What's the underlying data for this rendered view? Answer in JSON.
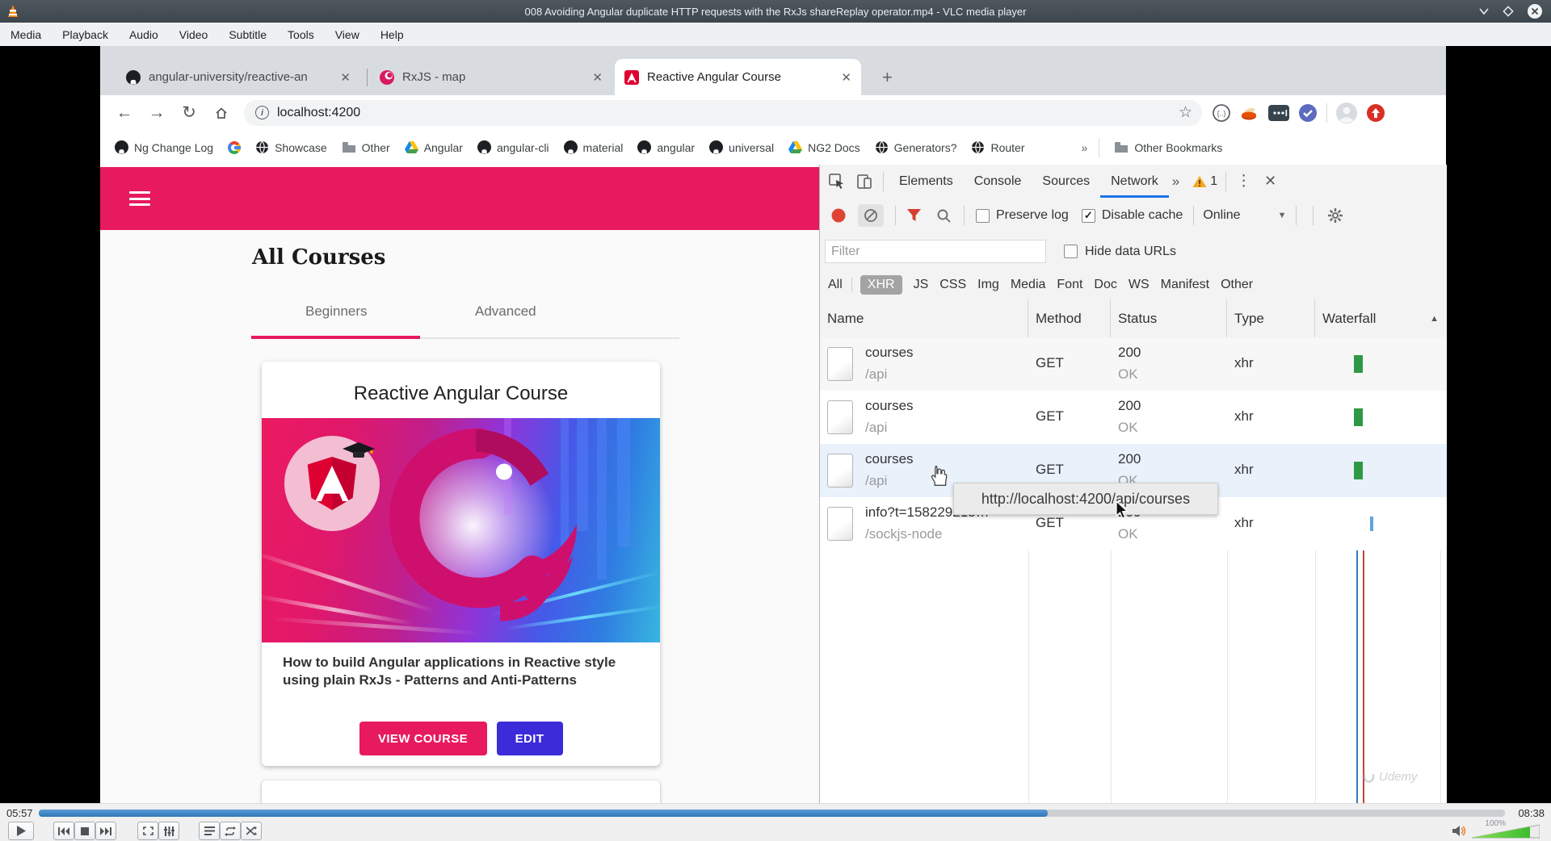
{
  "vlc": {
    "title": "008 Avoiding Angular duplicate HTTP requests with the RxJs shareReplay operator.mp4 - VLC media player",
    "menu": [
      "Media",
      "Playback",
      "Audio",
      "Video",
      "Subtitle",
      "Tools",
      "View",
      "Help"
    ],
    "time_elapsed": "05:57",
    "time_total": "08:38",
    "progress_percent": 68.8,
    "volume_label": "100%",
    "volume_percent": 100
  },
  "browser": {
    "tabs": [
      {
        "label": "angular-university/reactive-an",
        "icon": "github"
      },
      {
        "label": "RxJS - map",
        "icon": "rxjs"
      },
      {
        "label": "Reactive Angular Course",
        "icon": "angular"
      }
    ],
    "address": "localhost:4200",
    "bookmarks": {
      "b0": "Ng Change Log",
      "b1": "Showcase",
      "b2": "Other",
      "b3": "Angular",
      "b4": "angular-cli",
      "b5": "material",
      "b6": "angular",
      "b7": "universal",
      "b8": "NG2 Docs",
      "b9": "Generators?",
      "b10": "Router",
      "overflow": "»",
      "other": "Other Bookmarks"
    }
  },
  "page": {
    "title": "All Courses",
    "tabs": {
      "t0": "Beginners",
      "t1": "Advanced"
    },
    "card": {
      "title": "Reactive Angular Course",
      "description": "How to build Angular applications in Reactive style using plain RxJs - Patterns and Anti-Patterns",
      "view_label": "VIEW COURSE",
      "edit_label": "EDIT"
    }
  },
  "devtools": {
    "tabs": {
      "t0": "Elements",
      "t1": "Console",
      "t2": "Sources",
      "t3": "Network"
    },
    "active_tab": "Network",
    "warning_count": "1",
    "toolbar": {
      "preserve_log": "Preserve log",
      "disable_cache": "Disable cache",
      "throttling": "Online"
    },
    "filter_placeholder": "Filter",
    "hide_data_urls": "Hide data URLs",
    "type_filters": {
      "f0": "All",
      "f1": "XHR",
      "f2": "JS",
      "f3": "CSS",
      "f4": "Img",
      "f5": "Media",
      "f6": "Font",
      "f7": "Doc",
      "f8": "WS",
      "f9": "Manifest",
      "f10": "Other"
    },
    "selected_filter": "XHR",
    "columns": {
      "c0": "Name",
      "c1": "Method",
      "c2": "Status",
      "c3": "Type",
      "c4": "Waterfall"
    },
    "requests": {
      "r0": {
        "name": "courses",
        "path": "/api",
        "method": "GET",
        "status": "200",
        "status_text": "OK",
        "type": "xhr"
      },
      "r1": {
        "name": "courses",
        "path": "/api",
        "method": "GET",
        "status": "200",
        "status_text": "OK",
        "type": "xhr"
      },
      "r2": {
        "name": "courses",
        "path": "/api",
        "method": "GET",
        "status": "200",
        "status_text": "OK",
        "type": "xhr"
      },
      "r3": {
        "name": "info?t=158229213…",
        "path": "/sockjs-node",
        "method": "GET",
        "status": "200",
        "status_text": "OK",
        "type": "xhr"
      }
    },
    "tooltip": "http://localhost:4200/api/courses",
    "watermark": "Udemy"
  },
  "glyphs": {
    "back": "←",
    "forward": "→",
    "reload": "↻",
    "star": "☆",
    "close": "✕",
    "new_tab": "+",
    "more": "»",
    "menu_dots": "⋮",
    "sort_asc": "▲",
    "dropdown": "▼",
    "check": "✓",
    "secure_info": "i",
    "ext_braces": "{…}"
  },
  "colors": {
    "accent_pink": "#e7195f",
    "edit_blue": "#3c2bd9",
    "seek_blue": "#2f78b8",
    "devtools_active_blue": "#1a73e8",
    "waterfall_green": "#2e9945",
    "waterfall_dcl_blue": "#3b78c3",
    "waterfall_load_red": "#b9453c",
    "record_red": "#e04334",
    "angular_red": "#dd0031",
    "rxjs_pink": "#cf0f6e"
  }
}
